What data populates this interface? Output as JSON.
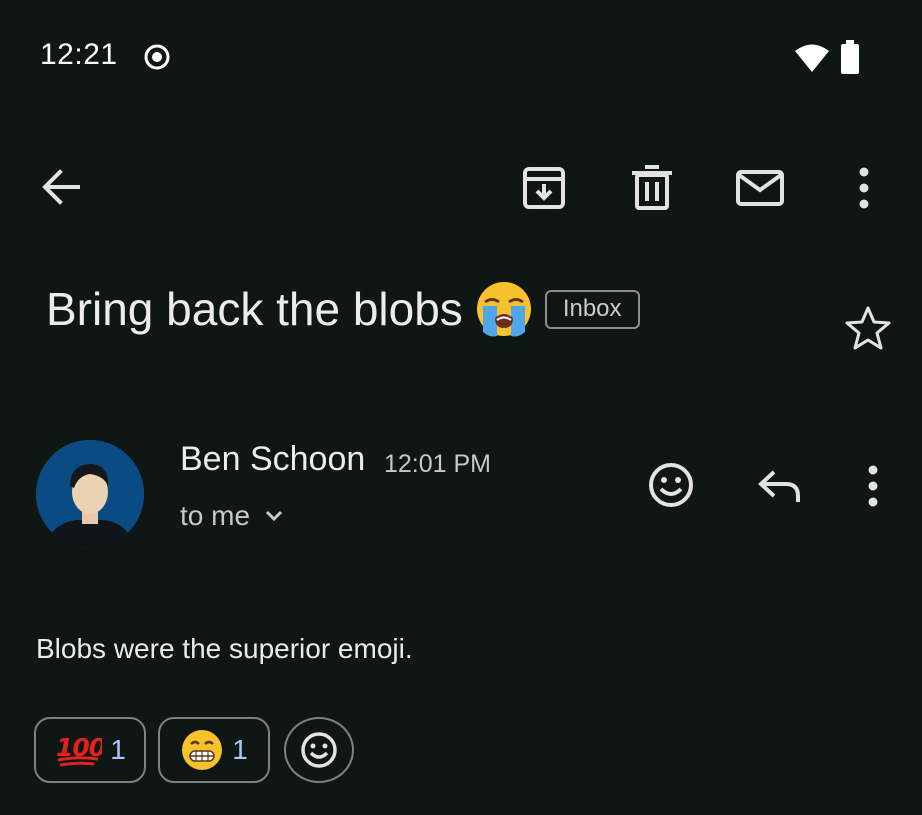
{
  "status_bar": {
    "time": "12:21",
    "icons": [
      "screen-record-icon",
      "wifi-icon",
      "battery-icon"
    ]
  },
  "toolbar": {
    "icons": [
      "back-arrow-icon",
      "archive-icon",
      "delete-icon",
      "mark-unread-icon",
      "more-vert-icon"
    ]
  },
  "email": {
    "subject": "Bring back the blobs",
    "subject_emoji": "loudly-crying-face",
    "label": "Inbox",
    "sender": {
      "name": "Ben Schoon",
      "time": "12:01 PM",
      "recipient": "to me"
    },
    "body": "Blobs were the superior emoji.",
    "reactions": [
      {
        "emoji": "hundred-points",
        "count": "1"
      },
      {
        "emoji": "grinning-face",
        "count": "1"
      }
    ]
  },
  "colors": {
    "background": "#0e1714",
    "text": "#e3e3e3",
    "accent_count": "#a8c7fa",
    "avatar_bg": "#0b4b84"
  }
}
